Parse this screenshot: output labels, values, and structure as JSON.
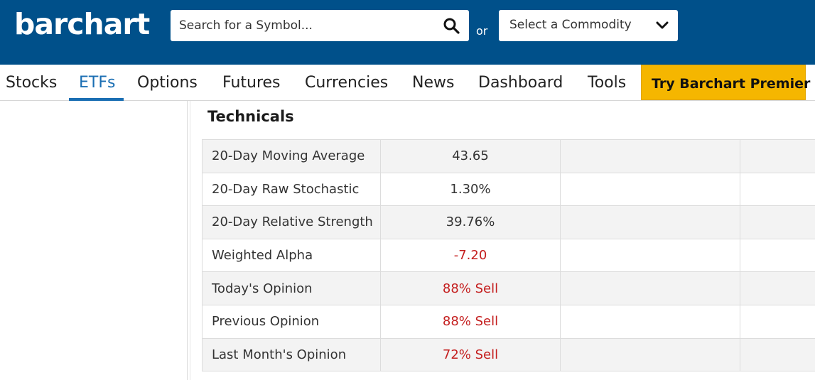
{
  "header": {
    "logo_text": "barchart",
    "search": {
      "placeholder": "Search for a Symbol...",
      "value": ""
    },
    "or_label": "or",
    "commodity_select": {
      "selected": "Select a Commodity"
    }
  },
  "nav": {
    "items": [
      {
        "label": "Stocks",
        "active": false
      },
      {
        "label": "ETFs",
        "active": true
      },
      {
        "label": "Options",
        "active": false
      },
      {
        "label": "Futures",
        "active": false
      },
      {
        "label": "Currencies",
        "active": false
      },
      {
        "label": "News",
        "active": false
      },
      {
        "label": "Dashboard",
        "active": false
      },
      {
        "label": "Tools",
        "active": false
      }
    ],
    "premium_label": "Try Barchart Premier"
  },
  "technicals": {
    "title": "Technicals",
    "rows": [
      {
        "label": "20-Day Moving Average",
        "value": "43.65"
      },
      {
        "label": "20-Day Raw Stochastic",
        "value": "1.30%"
      },
      {
        "label": "20-Day Relative Strength",
        "value": "39.76%"
      },
      {
        "label": "Weighted Alpha",
        "value": "-7.20"
      },
      {
        "label": "Today's Opinion",
        "value": "88% Sell"
      },
      {
        "label": "Previous Opinion",
        "value": "88% Sell"
      },
      {
        "label": "Last Month's Opinion",
        "value": "72% Sell"
      }
    ]
  },
  "colors": {
    "header_bg": "#00508a",
    "accent_blue": "#1a6eb3",
    "premium_bg": "#f5b600",
    "negative_red": "#c41e1e"
  },
  "icons": {
    "search": "search-icon",
    "dropdown": "chevron-down-icon"
  }
}
